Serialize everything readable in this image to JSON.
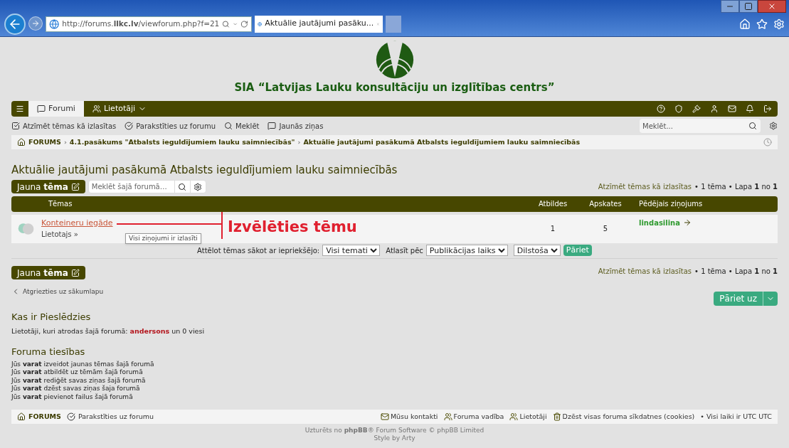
{
  "browser": {
    "url": "http://forums.**llkc.lv**/viewforum.php?f=21",
    "tab_title": "Aktuālie jautājumi pasāku..."
  },
  "header": {
    "org_name": "SIA “Latvijas Lauku konsultāciju un izglītības centrs”"
  },
  "navbar": {
    "tabs": [
      {
        "label": "Forumi",
        "selected": true
      },
      {
        "label": "Lietotāji",
        "selected": false
      }
    ]
  },
  "quick_links": [
    "Atzīmēt tēmas kā izlasītas",
    "Parakstīties uz forumu",
    "Meklēt",
    "Jaunās ziņas"
  ],
  "search": {
    "placeholder": "Meklēt..."
  },
  "breadcrumb_separators": [
    "›",
    "›"
  ],
  "breadcrumbs": [
    "FORUMS",
    "4.1.pasākums \"Atbalsts ieguldījumiem lauku saimniecībās\"",
    "Aktuālie jautājumi pasākumā Atbalsts ieguldījumiem lauku saimniecībās"
  ],
  "forum": {
    "title": "Aktuālie jautājumi pasākumā Atbalsts ieguldījumiem lauku saimniecībās",
    "new_topic": "Jauna **tēma**",
    "search_placeholder": "Meklēt šajā forumā…",
    "mark_read": "Atzīmēt tēmas kā izlasītas",
    "pagination": "• 1 tēma • Lapa **1** no **1**"
  },
  "table": {
    "columns": [
      "Tēmas",
      "Atbildes",
      "Apskates",
      "Pēdējais ziņojums"
    ],
    "rows": [
      {
        "title": "Konteineru iegāde",
        "author": "Lietotajs »",
        "replies": "1",
        "views": "5",
        "last_poster": "lindasilina"
      }
    ]
  },
  "tooltip": "Visi ziņojumi ir izlasīti",
  "annotation": "Izvēlēties tēmu",
  "sort": {
    "display_label": "Attēlot tēmas sākot ar iepriekšējo:",
    "display_value": "Visi temati",
    "sort_label": "Atlasīt pēc",
    "sort_value": "Publikācijas laiks",
    "order_value": "Dilstoša",
    "go": "Pāriet"
  },
  "bottom_bar": {
    "new_topic": "Jauna **tēma**",
    "mark_read": "Atzīmēt tēmas kā izlasītas",
    "pagination": "• 1 tēma • Lapa **1** no **1**"
  },
  "back_link": "Atgriezties uz sākumlapu",
  "jump_to": "Pāriet uz",
  "who_online": {
    "title": "Kas ir Pieslēdzies",
    "text": "Lietotāji, kuri atrodas šajā forumā:",
    "user": "andersons",
    "guests": "un 0 viesi"
  },
  "permissions": {
    "title": "Foruma tiesības",
    "lines": [
      "Jūs **varat** izveidot jaunas tēmas šajā forumā",
      "Jūs **varat** atbildēt uz tēmām šajā forumā",
      "Jūs **varat** rediģēt savas ziņas šajā forumā",
      "Jūs **varat** dzēst savas ziņas šaja forumā",
      "Jūs **varat** pievienot failus šajā forumā"
    ]
  },
  "footer": {
    "home": "FORUMS",
    "subscribe": "Parakstīties uz forumu",
    "links": [
      "Mūsu kontakti",
      "Foruma vadība",
      "Lietotāji",
      "Dzēst visas foruma sīkdatnes (cookies)"
    ],
    "timezone": "• Visi laiki ir UTC UTC"
  },
  "credits": [
    "Uzturēts no **phpBB**® Forum Software © phpBB Limited",
    "Style by Arty"
  ]
}
